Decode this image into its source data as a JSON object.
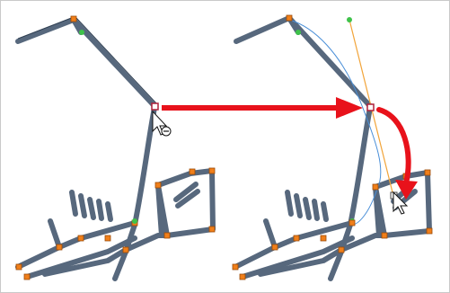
{
  "illustration": {
    "before_panel": {
      "description_icon": "remove-point-cursor-icon"
    },
    "after_panel": {
      "description_icon": "arrow-cursor-icon"
    },
    "colors": {
      "stroke_body": "#57687d",
      "stroke_edge": "#3a4a5c",
      "control_point": "#f07f1a",
      "control_point_edge": "#9a4a08",
      "selected_point": "#ffffff",
      "selected_point_edge": "#b0203a",
      "handle_green": "#3ec24a",
      "bezier_line": "#4a8fd8",
      "tangent_line": "#f2a43a",
      "arrow_red": "#e8121b",
      "frame_border": "#c9c9c9"
    }
  }
}
